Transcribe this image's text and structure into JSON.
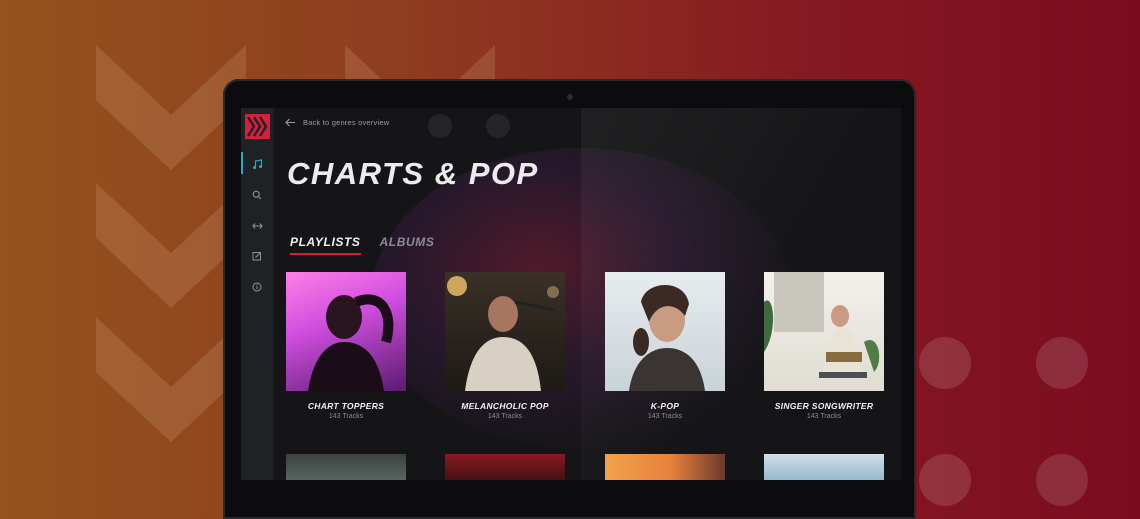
{
  "nav": {
    "back_label": "Back to genres overview",
    "items": [
      {
        "icon": "music-note-icon",
        "active": true
      },
      {
        "icon": "search-icon",
        "active": false
      },
      {
        "icon": "arrows-icon",
        "active": false
      },
      {
        "icon": "edit-icon",
        "active": false
      },
      {
        "icon": "info-icon",
        "active": false
      }
    ]
  },
  "page": {
    "title": "CHARTS & POP",
    "tabs": [
      {
        "label": "PLAYLISTS",
        "active": true
      },
      {
        "label": "ALBUMS",
        "active": false
      }
    ]
  },
  "playlists": [
    {
      "title": "CHART TOPPERS",
      "tracks": "143 Tracks"
    },
    {
      "title": "MELANCHOLIC POP",
      "tracks": "143 Tracks"
    },
    {
      "title": "K-POP",
      "tracks": "143 Tracks"
    },
    {
      "title": "SINGER SONGWRITER",
      "tracks": "143 Tracks"
    }
  ],
  "colors": {
    "accent": "#d5203c",
    "nav_active": "#2aa8c9",
    "screen_bg": "#151517"
  }
}
